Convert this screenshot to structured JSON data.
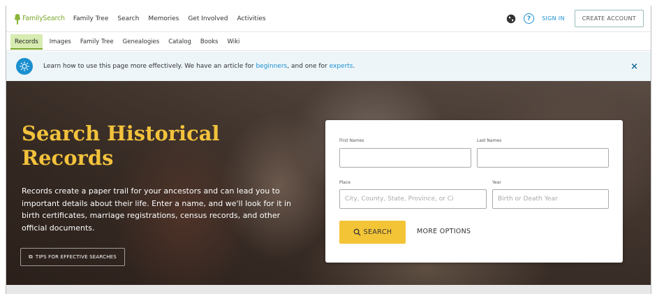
{
  "top_nav": {
    "logo_text": "FamilySearch",
    "items": [
      "Family Tree",
      "Search",
      "Memories",
      "Get Involved",
      "Activities"
    ],
    "globe_icon": "globe-icon",
    "help_icon": "help-icon",
    "help_glyph": "?",
    "sign_in": "SIGN IN",
    "create_account": "CREATE ACCOUNT"
  },
  "sub_nav": {
    "active": "Records",
    "items": [
      "Images",
      "Family Tree",
      "Genealogies",
      "Catalog",
      "Books",
      "Wiki"
    ]
  },
  "banner": {
    "icon": "lightbulb-icon",
    "text_before": "Learn how to use this page more effectively. We have an article for ",
    "link1": "beginners",
    "text_middle": ", and one for ",
    "link2": "experts",
    "text_after": ".",
    "close": "×"
  },
  "hero": {
    "title": "Search Historical Records",
    "description": "Records create a paper trail for your ancestors and can lead you to important details about their life. Enter a name, and we'll look for it in birth certificates, marriage registrations, census records, and other official documents.",
    "tips_icon": "external-link-icon",
    "tips_button": "TIPS FOR EFFECTIVE SEARCHES"
  },
  "search_form": {
    "first_names_label": "First Names",
    "first_names_value": "",
    "last_names_label": "Last Names",
    "last_names_value": "",
    "place_label": "Place",
    "place_placeholder": "City, County, State, Province, or Ci",
    "year_label": "Year",
    "year_placeholder": "Birth or Death Year",
    "search_button": "SEARCH",
    "more_options": "MORE OPTIONS"
  },
  "colors": {
    "brand_green": "#7aa82c",
    "link_blue": "#1b8fd0",
    "title_gold": "#f2c23c",
    "button_yellow": "#f4c437"
  }
}
